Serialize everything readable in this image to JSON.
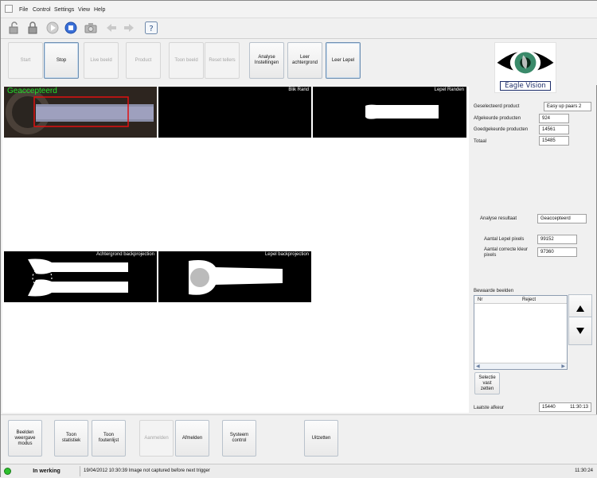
{
  "menu": [
    "File",
    "Control",
    "Settings",
    "View",
    "Help"
  ],
  "toolbar_icons": [
    "lock-open-icon",
    "lock-icon",
    "play-icon",
    "stop-icon",
    "camera-icon",
    "back-arrow-icon",
    "forward-arrow-icon",
    "help-icon"
  ],
  "commands": {
    "start": "Start",
    "stop": "Stop",
    "live": "Live beeld",
    "product": "Product",
    "toon_beeld": "Toon beeld",
    "reset": "Reset tellers",
    "analyse": "Analyse Instellingen",
    "leer_achtergrond": "Leer achtergrond",
    "leer_lepel": "Leer Lepel"
  },
  "logo": {
    "text": "Eagle Vision"
  },
  "panels": {
    "main_status": "Geaccepteerd",
    "blik_rand": "Blik Rand",
    "lepel_randen": "Lepel Randen",
    "achtergrond_bp": "Achtergrond backprojection",
    "lepel_bp": "Lepel backprojection"
  },
  "stats": {
    "product_label": "Geselecteerd product",
    "product_value": "Easy up paars 2",
    "rejected_label": "Afgekeurde producten",
    "rejected_value": "924",
    "approved_label": "Goedgekeurde producten",
    "approved_value": "14561",
    "total_label": "Totaal",
    "total_value": "15485"
  },
  "analysis": {
    "result_label": "Analyse resultaat",
    "result_value": "Geaccepteerd",
    "pixels_label": "Aantal Lepel pixels",
    "pixels_value": "99152",
    "color_label": "Aantal correcte kleur pixels",
    "color_value": "97360"
  },
  "saved": {
    "title": "Bewaarde beelden",
    "col_nr": "Nr",
    "col_reject": "Reject",
    "select_button": "Selectie vast zetten"
  },
  "last_reject": {
    "label": "Laatste afkeur",
    "count": "15440",
    "time": "11:30:13"
  },
  "bottom": {
    "beelden": "Beelden weergave modus",
    "statistiek": "Toon statistiek",
    "foutenlijst": "Toon foutenlijst",
    "aanmelden": "Aanmelden",
    "afmelden": "Afmelden",
    "systeem": "Systeem control",
    "uitzetten": "Uitzetten"
  },
  "status": {
    "state": "In werking",
    "message": "19/04/2012 10:30:39 Image not captured before next trigger",
    "clock": "11:30:24",
    "indicator_color": "#2ec02e"
  }
}
